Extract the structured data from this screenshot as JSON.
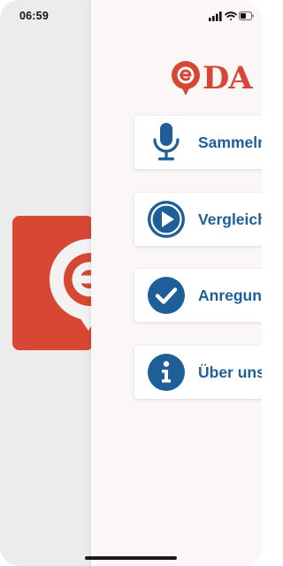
{
  "status_bar": {
    "time": "06:59",
    "signal_icon": "signal-bars-icon",
    "wifi_icon": "wifi-icon",
    "battery_icon": "battery-icon"
  },
  "app_icon": {
    "icon": "e-speech-bubble-icon",
    "color": "#d84634"
  },
  "logo": {
    "mark_icon": "e-speech-bubble-icon",
    "text": "DA",
    "color": "#d84634"
  },
  "menu": {
    "accent": "#1f5f99",
    "items": [
      {
        "label": "Sammeln",
        "icon": "microphone-icon"
      },
      {
        "label": "Vergleich",
        "icon": "play-circle-icon"
      },
      {
        "label": "Anregung",
        "icon": "check-circle-icon"
      },
      {
        "label": "Über uns",
        "icon": "info-circle-icon"
      }
    ]
  }
}
